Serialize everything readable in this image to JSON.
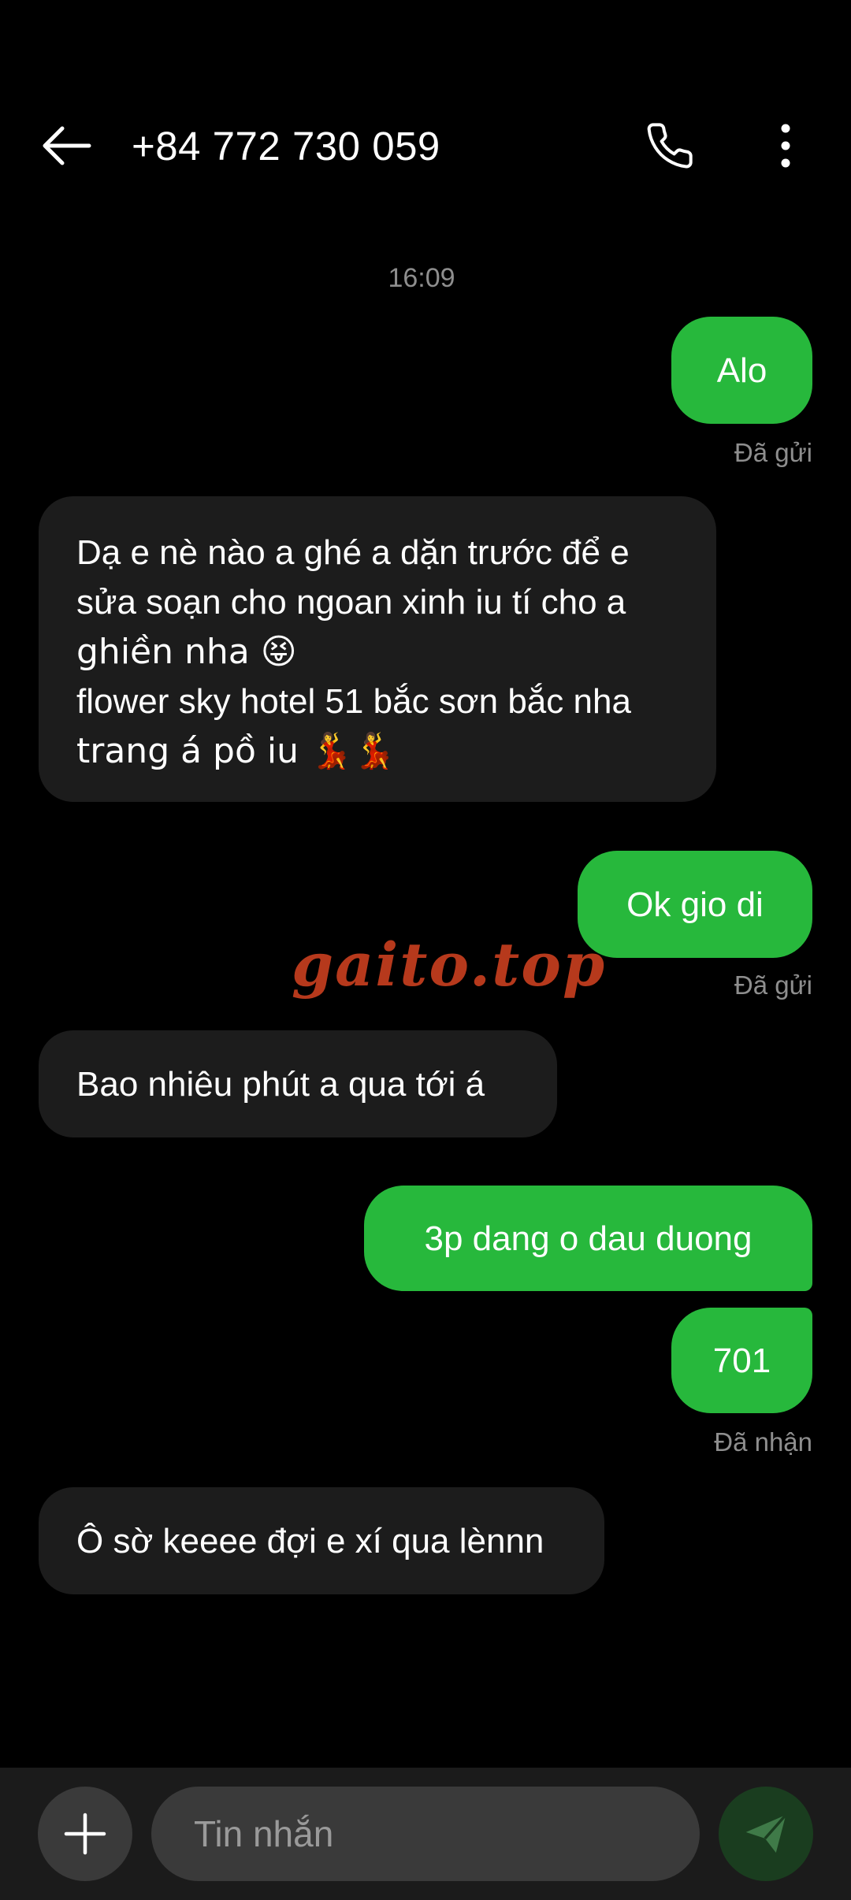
{
  "header": {
    "title": "+84 772 730 059",
    "icons": {
      "back": "arrow-left-icon",
      "call": "phone-icon",
      "more": "more-vertical-icon"
    }
  },
  "conversation": {
    "time_separator": "16:09",
    "messages": [
      {
        "direction": "outgoing",
        "text": "Alo",
        "status": "Đã gửi"
      },
      {
        "direction": "incoming",
        "lines": [
          "Dạ e nè nào a ghé a dặn trước để e",
          "sửa soạn cho ngoan xinh iu tí cho a",
          "ghiền nha 😝",
          "flower sky hotel 51 bắc sơn bắc nha",
          "trang á pồ iu 💃💃"
        ]
      },
      {
        "direction": "outgoing",
        "text": "Ok gio di",
        "status": "Đã gửi"
      },
      {
        "direction": "incoming",
        "text": "Bao nhiêu phút a qua tới á"
      },
      {
        "direction": "outgoing",
        "text": "3p dang o dau duong"
      },
      {
        "direction": "outgoing",
        "text": "701",
        "status": "Đã nhận"
      },
      {
        "direction": "incoming",
        "text": "Ô sờ keeee đợi e xí qua lènnn"
      }
    ]
  },
  "watermark": "gaito.top",
  "composer": {
    "placeholder": "Tin nhắn",
    "value": "",
    "icons": {
      "add": "plus-icon",
      "send": "send-icon"
    }
  },
  "colors": {
    "background": "#000000",
    "outgoing_bubble": "#27b83c",
    "incoming_bubble": "#1c1c1c",
    "secondary_text": "#8e8e8e",
    "watermark": "#b6391c",
    "send_button": "#1a3d1f"
  }
}
